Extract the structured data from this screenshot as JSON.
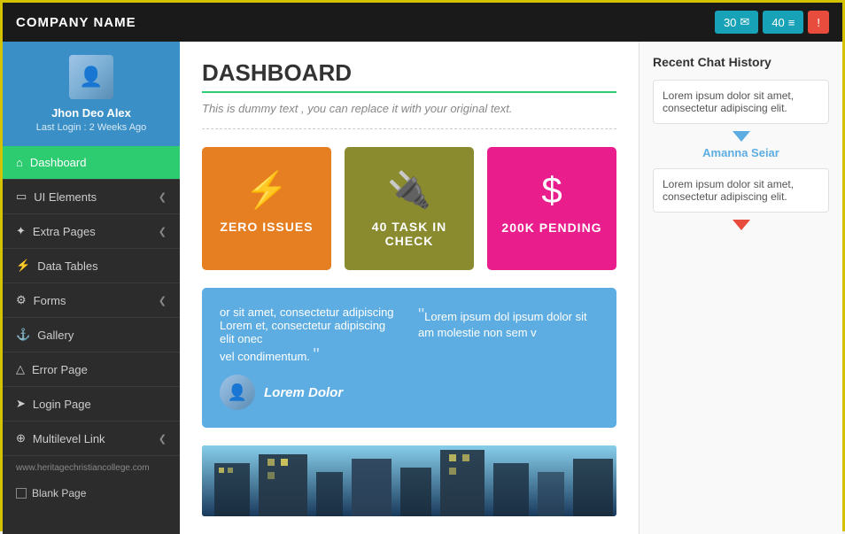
{
  "company": {
    "name": "COMPANY NAME"
  },
  "topnav": {
    "mail_count": "30",
    "list_count": "40",
    "mail_icon": "✉",
    "list_icon": "≡",
    "alert_icon": "!"
  },
  "sidebar": {
    "username": "Jhon Deo Alex",
    "last_login": "Last Login : 2 Weeks Ago",
    "nav_items": [
      {
        "label": "Dashboard",
        "icon": "⌂",
        "active": true,
        "has_chevron": false
      },
      {
        "label": "UI Elements",
        "icon": "▭",
        "active": false,
        "has_chevron": true
      },
      {
        "label": "Extra Pages",
        "icon": "✦",
        "active": false,
        "has_chevron": true
      },
      {
        "label": "Data Tables",
        "icon": "⚡",
        "active": false,
        "has_chevron": false
      },
      {
        "label": "Forms",
        "icon": "⚙",
        "active": false,
        "has_chevron": true
      },
      {
        "label": "Gallery",
        "icon": "⚓",
        "active": false,
        "has_chevron": false
      },
      {
        "label": "Error Page",
        "icon": "△",
        "active": false,
        "has_chevron": false
      },
      {
        "label": "Login Page",
        "icon": "➤",
        "active": false,
        "has_chevron": false
      },
      {
        "label": "Multilevel Link",
        "icon": "⊕",
        "active": false,
        "has_chevron": true
      }
    ],
    "footer_url": "www.heritagechristiancollege.com",
    "blank_page": "Blank Page"
  },
  "main": {
    "title": "DASHBOARD",
    "subtitle": "This is dummy text , you can replace it with your original text.",
    "stat_cards": [
      {
        "label": "ZERO ISSUES",
        "icon": "⚡",
        "color": "orange"
      },
      {
        "label": "40 TASK IN CHECK",
        "icon": "🔌",
        "color": "olive"
      },
      {
        "label": "200K PENDING",
        "icon": "$",
        "color": "pink"
      }
    ],
    "testimonial": {
      "left_text": "or sit amet, consectetur adipiscing Lorem et, consectetur adipiscing elit onec vel condimentum.",
      "right_text": "Lorem ipsum dol ipsum dolor sit am molestie non sem v",
      "author_name": "Lorem Dolor",
      "quote_open": "““",
      "quote_close": "””"
    }
  },
  "chat": {
    "title": "Recent Chat History",
    "messages": [
      {
        "text": "Lorem ipsum dolor sit amet, consectetur adipiscing elit."
      },
      {
        "text": "Lorem ipsum dolor sit amet, consectetur adipiscing elit."
      }
    ],
    "sender_name": "Amanna Seiar"
  }
}
